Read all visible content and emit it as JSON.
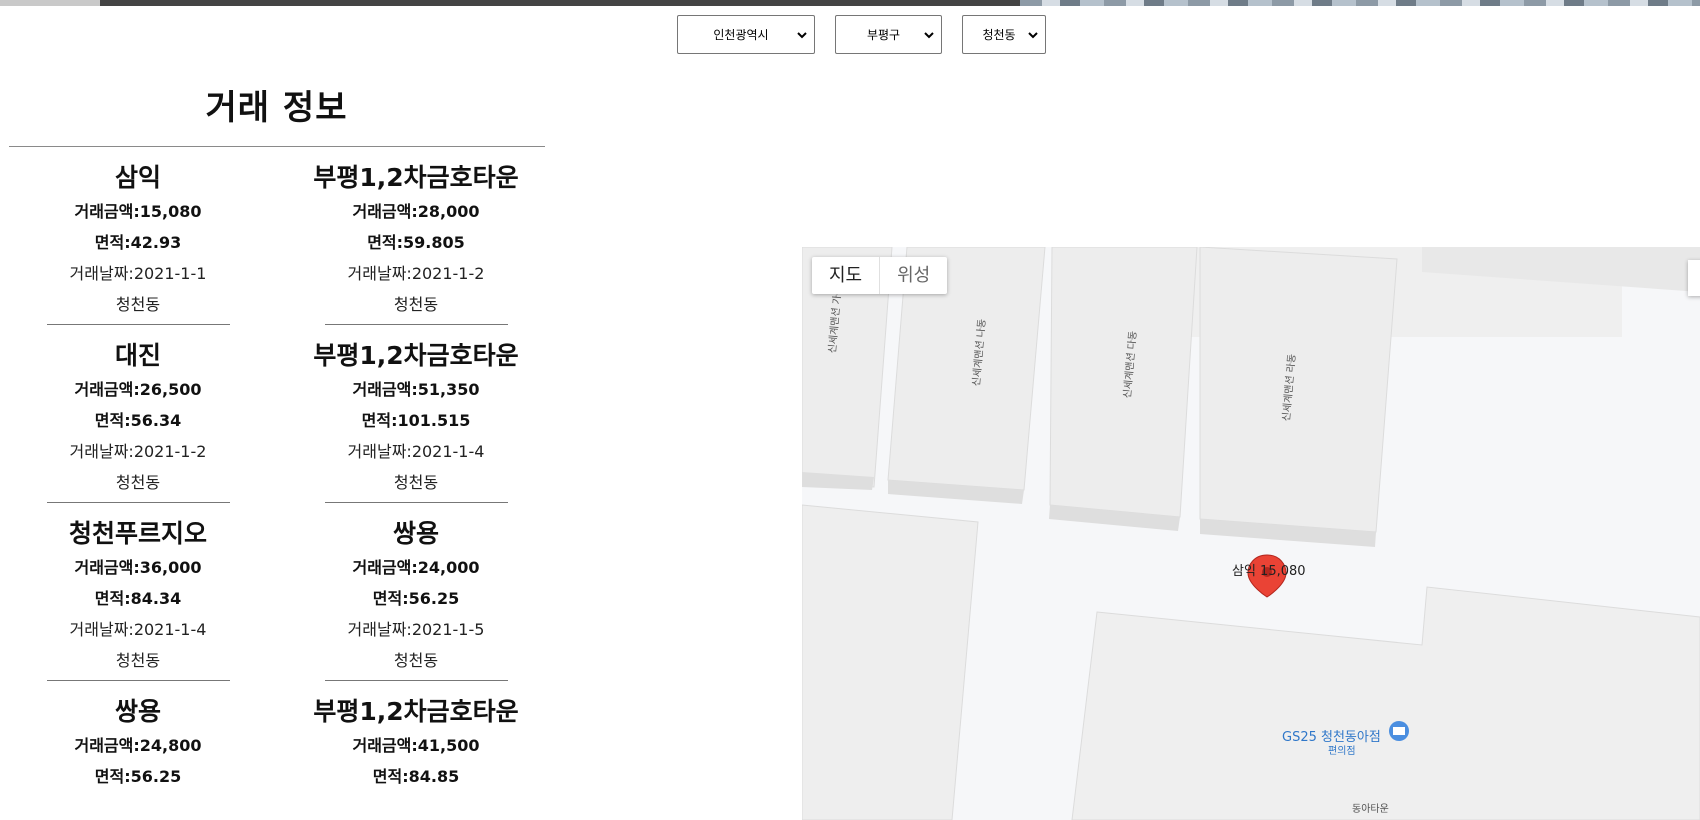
{
  "filters": {
    "city": "인천광역시",
    "district": "부평구",
    "dong": "청천동"
  },
  "panel": {
    "title": "거래 정보"
  },
  "deals": [
    {
      "name": "삼익",
      "price": "거래금액:15,080",
      "area": "면적:42.93",
      "date": "거래날짜:2021-1-1",
      "dong": "청천동"
    },
    {
      "name": "부평1,2차금호타운",
      "price": "거래금액:28,000",
      "area": "면적:59.805",
      "date": "거래날짜:2021-1-2",
      "dong": "청천동"
    },
    {
      "name": "대진",
      "price": "거래금액:26,500",
      "area": "면적:56.34",
      "date": "거래날짜:2021-1-2",
      "dong": "청천동"
    },
    {
      "name": "부평1,2차금호타운",
      "price": "거래금액:51,350",
      "area": "면적:101.515",
      "date": "거래날짜:2021-1-4",
      "dong": "청천동"
    },
    {
      "name": "청천푸르지오",
      "price": "거래금액:36,000",
      "area": "면적:84.34",
      "date": "거래날짜:2021-1-4",
      "dong": "청천동"
    },
    {
      "name": "쌍용",
      "price": "거래금액:24,000",
      "area": "면적:56.25",
      "date": "거래날짜:2021-1-5",
      "dong": "청천동"
    },
    {
      "name": "쌍용",
      "price": "거래금액:24,800",
      "area": "면적:56.25",
      "date": "",
      "dong": ""
    },
    {
      "name": "부평1,2차금호타운",
      "price": "거래금액:41,500",
      "area": "면적:84.85",
      "date": "",
      "dong": ""
    }
  ],
  "map": {
    "type_map": "지도",
    "type_satellite": "위성",
    "marker_label": "삼익 15,080",
    "poi_name": "GS25 청천동아점",
    "poi_sub": "편의점",
    "roads": [
      "신세계맨션 가동",
      "신세계맨션 나동",
      "신세계맨션 다동",
      "신세계맨션 라동",
      "동아타운"
    ],
    "marker_color": "#ea4335",
    "poi_color": "#2f77c9"
  }
}
